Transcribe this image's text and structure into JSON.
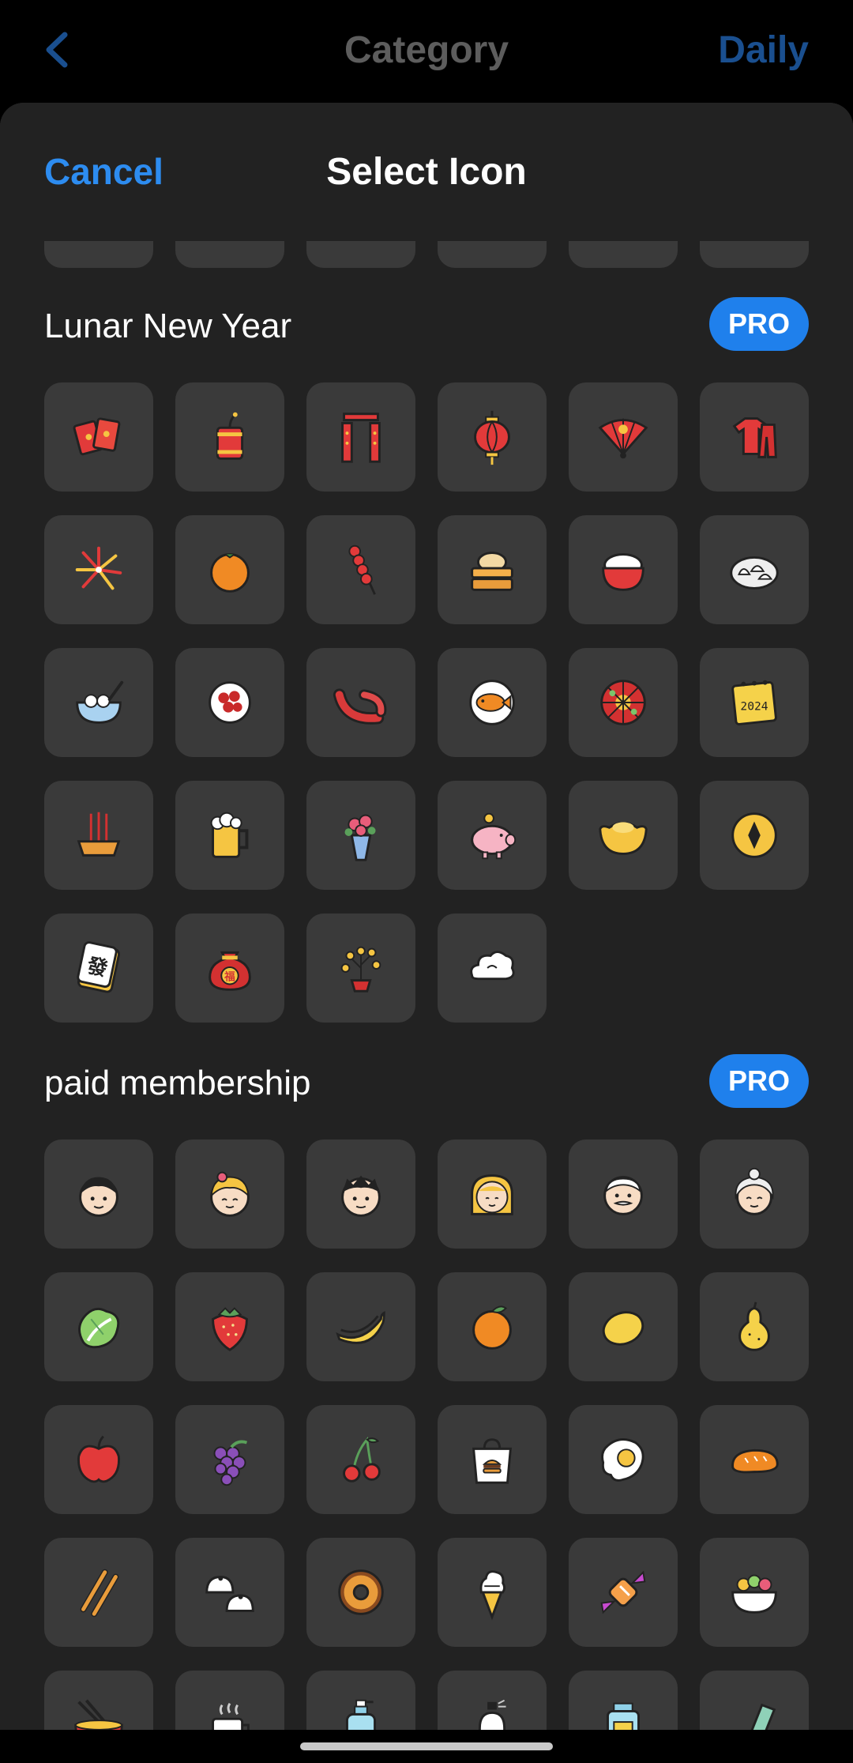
{
  "nav": {
    "back_icon": "chevron-left-icon",
    "title": "Category",
    "right_label": "Daily"
  },
  "sheet": {
    "cancel_label": "Cancel",
    "title": "Select Icon"
  },
  "colors": {
    "accent": "#2d8cf0",
    "pro_badge": "#1f80ec",
    "tile": "#3a3a3a",
    "sheet": "#222222"
  },
  "sections": [
    {
      "title": "Lunar New Year",
      "badge": "PRO",
      "icons": [
        "red-envelopes-icon",
        "firecracker-icon",
        "couplets-icon",
        "lantern-icon",
        "folding-fan-icon",
        "red-clothes-icon",
        "fireworks-icon",
        "tangerine-icon",
        "candied-haws-icon",
        "steamed-bun-basket-icon",
        "rice-bowl-icon",
        "dumplings-icon",
        "sweet-dumpling-soup-icon",
        "fruit-bowl-icon",
        "sausage-icon",
        "fish-plate-icon",
        "candy-tray-icon",
        "calendar-2024-icon",
        "incense-burner-icon",
        "beer-mug-icon",
        "flower-bouquet-icon",
        "piggy-bank-icon",
        "gold-ingot-icon",
        "gold-coin-icon",
        "mahjong-tile-icon",
        "lucky-bag-icon",
        "money-tree-icon",
        "auspicious-cloud-icon"
      ],
      "calendar_text": "2024",
      "mahjong_text": "發",
      "bag_text": "福"
    },
    {
      "title": "paid membership",
      "badge": "PRO",
      "icons": [
        "boy-face-icon",
        "girl-face-icon",
        "man-face-icon",
        "woman-face-icon",
        "grandpa-face-icon",
        "grandma-face-icon",
        "lettuce-icon",
        "strawberry-icon",
        "banana-icon",
        "orange-icon",
        "lemon-icon",
        "pear-icon",
        "apple-icon",
        "grapes-icon",
        "cherry-icon",
        "burger-bag-icon",
        "fried-egg-icon",
        "bread-icon",
        "chopsticks-icon",
        "buns-icon",
        "donut-icon",
        "ice-cream-icon",
        "candy-icon",
        "salad-bowl-icon",
        "noodle-bowl-icon",
        "hot-cup-icon",
        "lotion-bottle-icon",
        "perfume-icon",
        "jar-icon",
        "tube-icon"
      ]
    }
  ]
}
